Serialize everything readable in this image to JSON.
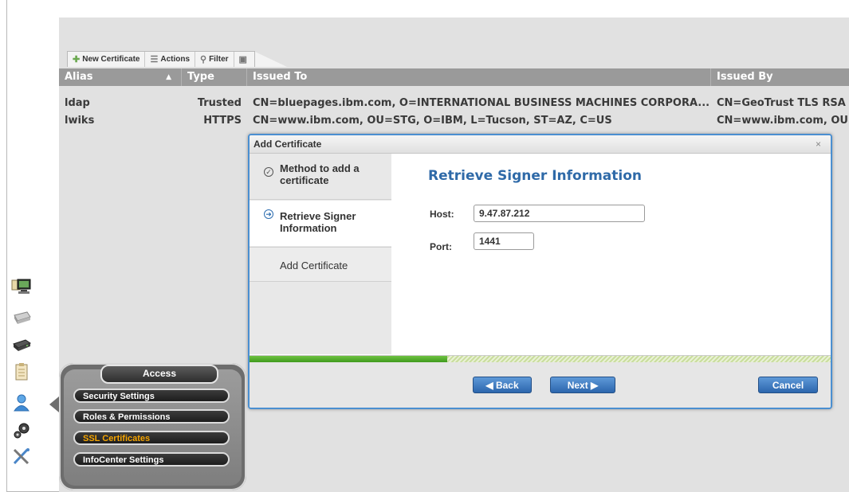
{
  "toolbar": {
    "new_certificate": "New Certificate",
    "actions": "Actions",
    "filter": "Filter"
  },
  "table": {
    "columns": [
      "Alias",
      "Type",
      "Issued To",
      "Issued By"
    ],
    "rows": [
      {
        "alias": "ldap",
        "type": "Trusted",
        "issued_to": "CN=bluepages.ibm.com, O=INTERNATIONAL BUSINESS MACHINES CORPORA...",
        "issued_by": "CN=GeoTrust TLS RSA"
      },
      {
        "alias": "lwiks",
        "type": "HTTPS",
        "issued_to": "CN=www.ibm.com, OU=STG, O=IBM, L=Tucson, ST=AZ, C=US",
        "issued_by": "CN=www.ibm.com, OU="
      }
    ]
  },
  "dialog": {
    "title": "Add Certificate",
    "close": "×",
    "steps": [
      {
        "label": "Method to add a certificate",
        "state": "done"
      },
      {
        "label": "Retrieve Signer Information",
        "state": "current"
      },
      {
        "label": "Add Certificate",
        "state": "pending"
      }
    ],
    "heading": "Retrieve Signer Information",
    "host_label": "Host:",
    "host_value": "9.47.87.212",
    "port_label": "Port:",
    "port_value": "1441",
    "progress": 0.34,
    "back": "◀ Back",
    "next": "Next ▶",
    "cancel": "Cancel"
  },
  "access_menu": {
    "title": "Access",
    "items": [
      "Security Settings",
      "Roles & Permissions",
      "SSL Certificates",
      "InfoCenter Settings"
    ],
    "active": "SSL Certificates"
  },
  "colors": {
    "accent": "#2f6aa8",
    "active_menu": "#f5a400",
    "progress": "#4fab28"
  }
}
